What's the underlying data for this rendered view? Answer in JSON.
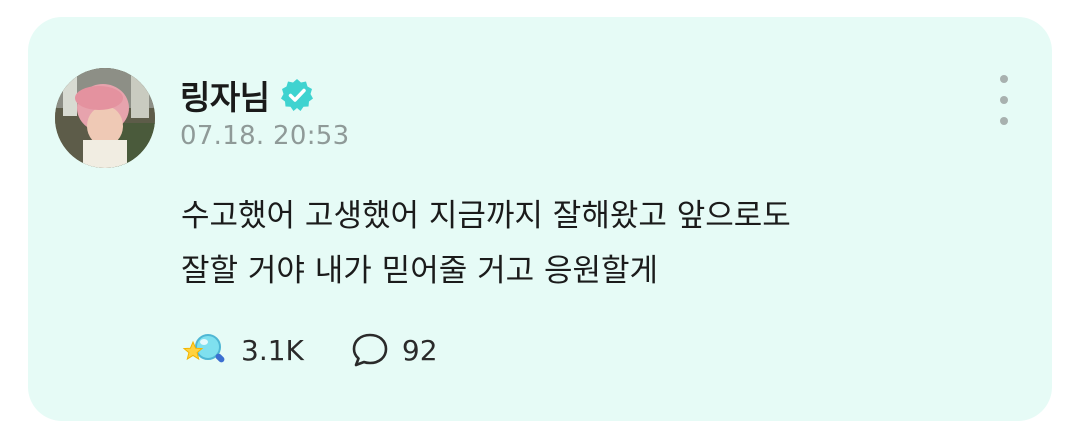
{
  "post": {
    "author": "링자님",
    "verified": true,
    "verified_icon": "verified-badge-icon",
    "timestamp": "07.18. 20:53",
    "body_lines": [
      "수고했어 고생했어 지금까지 잘해왔고 앞으로도",
      "잘할 거야 내가 믿어줄 거고 응원할게"
    ],
    "reactions": {
      "icon": "star-magnifier-reaction-icon",
      "count": "3.1K"
    },
    "comments": {
      "icon": "speech-bubble-icon",
      "count": "92"
    },
    "more_icon": "more-vertical-icon"
  },
  "colors": {
    "card_background": "#e6fbf6",
    "verified_badge": "#3fd3d0",
    "timestamp": "#8f9a98",
    "text": "#1b1b1b"
  }
}
